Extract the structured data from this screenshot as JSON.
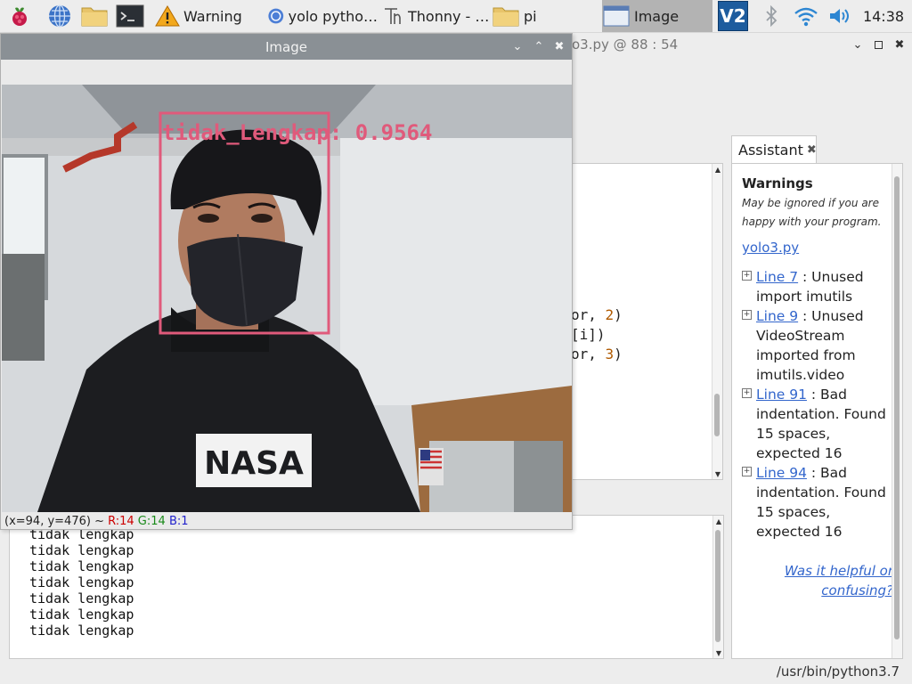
{
  "taskbar": {
    "apps": [
      {
        "label": "Warning",
        "icon": "warning-icon"
      },
      {
        "label": "yolo pytho…",
        "icon": "chromium-icon"
      },
      {
        "label": "Thonny  -  …",
        "icon": "thonny-icon"
      },
      {
        "label": "pi",
        "icon": "folder-icon"
      },
      {
        "label": "Image",
        "icon": "window-icon",
        "active": true
      }
    ],
    "clock": "14:38",
    "vnc_label": "V2"
  },
  "thonny": {
    "title_fragment": "o3.py  @  88 : 54",
    "editor_lines": [
      {
        "text": "or, ",
        "num": "2",
        "end": ")"
      },
      {
        "text": "[i])",
        "num": "",
        "end": ""
      },
      {
        "text": "or, ",
        "num": "3",
        "end": ")"
      }
    ],
    "shell_lines": [
      "tidak lengkap",
      "tidak lengkap",
      "tidak lengkap",
      "tidak lengkap",
      "tidak lengkap",
      "tidak lengkap",
      "tidak lengkap"
    ],
    "status": "/usr/bin/python3.7"
  },
  "assistant": {
    "tab_label": "Assistant",
    "heading": "Warnings",
    "note": "May be ignored if you are happy with your program.",
    "file_link": "yolo3.py",
    "warnings": [
      {
        "link": "Line 7",
        "text": " : Unused import imutils"
      },
      {
        "link": "Line 9",
        "text": " : Unused VideoStream imported from imutils.video"
      },
      {
        "link": "Line 91",
        "text": " : Bad indentation. Found 15 spaces, expected 16"
      },
      {
        "link": "Line 94",
        "text": " : Bad indentation. Found 15 spaces, expected 16"
      }
    ],
    "feedback": "Was it helpful or confusing?"
  },
  "image_window": {
    "title": "Image",
    "detection_label": "tidak_Lengkap: 0.9564",
    "shirt_logo": "NASA",
    "coord_prefix": "(x=94, y=476) ~ ",
    "r": "R:14",
    "g": "G:14",
    "b": "B:1"
  }
}
